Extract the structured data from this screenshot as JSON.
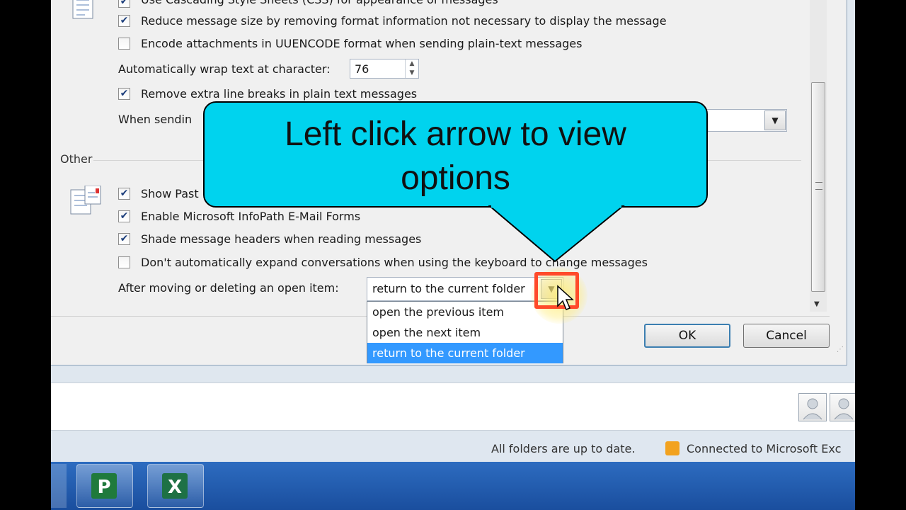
{
  "dialog": {
    "options_top": [
      {
        "label": "Use Cascading Style Sheets (CSS) for appearance of messages",
        "checked": true
      },
      {
        "label": "Reduce message size by removing format information not necessary to display the message",
        "checked": true
      },
      {
        "label": "Encode attachments in UUENCODE format when sending plain-text messages",
        "checked": false
      }
    ],
    "wrap_label": "Automatically wrap text at character:",
    "wrap_value": "76",
    "remove_breaks": {
      "label": "Remove extra line breaks in plain text messages",
      "checked": true
    },
    "when_sending_label": "When sendin",
    "section_other": "Other",
    "options_other": [
      {
        "label": "Show Past",
        "checked": true
      },
      {
        "label": "Enable Microsoft InfoPath E-Mail Forms",
        "checked": true
      },
      {
        "label": "Shade message headers when reading messages",
        "checked": true
      },
      {
        "label": "Don't automatically expand conversations when using the keyboard to change messages",
        "checked": false
      }
    ],
    "after_moving_label": "After moving or deleting an open item:",
    "after_moving_value": "return to the current folder",
    "dropdown_options": [
      "open the previous item",
      "open the next item",
      "return to the current folder"
    ],
    "ok_label": "OK",
    "cancel_label": "Cancel"
  },
  "callout": {
    "line1": "Left click arrow to view",
    "line2": "options"
  },
  "status": {
    "sync": "All folders are up to date.",
    "connection": "Connected to Microsoft Exc"
  },
  "colors": {
    "callout": "#00d3ee",
    "highlight": "#ff4a2a",
    "selection": "#3399ff",
    "taskbar": "#1a4e9e"
  }
}
